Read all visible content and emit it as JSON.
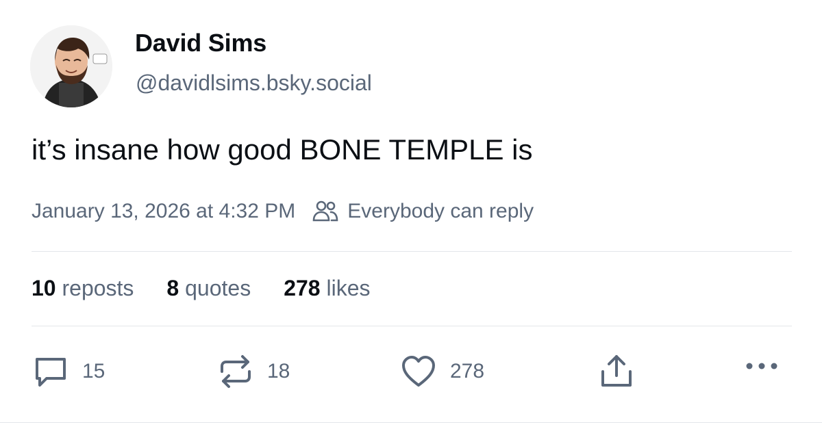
{
  "author": {
    "display_name": "David Sims",
    "handle": "@davidlsims.bsky.social",
    "avatar_icon": "avatar-illustration"
  },
  "post": {
    "text": "it’s insane how good BONE TEMPLE is",
    "timestamp": "January 13, 2026 at 4:32 PM",
    "reply_setting": "Everybody can reply"
  },
  "stats": {
    "reposts_count": "10",
    "reposts_label": "reposts",
    "quotes_count": "8",
    "quotes_label": "quotes",
    "likes_count": "278",
    "likes_label": "likes"
  },
  "actions": {
    "reply_count": "15",
    "repost_count": "18",
    "like_count": "278",
    "icons": [
      "reply-icon",
      "repost-icon",
      "heart-icon",
      "share-icon",
      "more-icon"
    ]
  },
  "colors": {
    "text_primary": "#0b0f14",
    "text_secondary": "#5a6779",
    "divider": "#e3e6ea"
  }
}
